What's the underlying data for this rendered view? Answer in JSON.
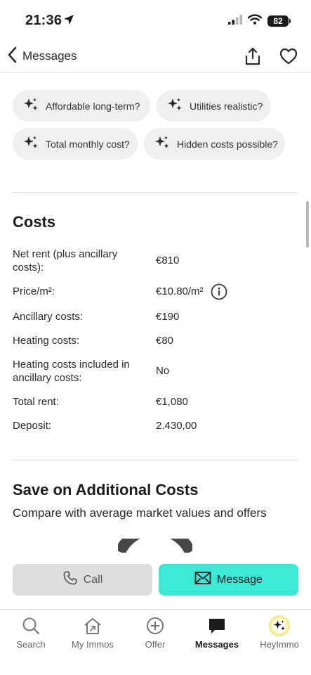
{
  "status": {
    "time": "21:36",
    "battery": "82"
  },
  "header": {
    "back_label": "Messages"
  },
  "chips": [
    {
      "label": "Affordable long-term?"
    },
    {
      "label": "Utilities realistic?"
    },
    {
      "label": "Total monthly cost?"
    },
    {
      "label": "Hidden costs possible?"
    }
  ],
  "costs": {
    "title": "Costs",
    "rows": [
      {
        "label": "Net rent (plus ancillary costs):",
        "value": "€810"
      },
      {
        "label": "Price/m²:",
        "value": "€10.80/m²"
      },
      {
        "label": "Ancillary costs:",
        "value": "€190"
      },
      {
        "label": "Heating costs:",
        "value": "€80"
      },
      {
        "label": "Heating costs included in ancillary costs:",
        "value": "No"
      },
      {
        "label": "Total rent:",
        "value": "€1,080"
      },
      {
        "label": "Deposit:",
        "value": "2.430,00"
      }
    ]
  },
  "savings": {
    "title": "Save on Additional Costs",
    "subtitle": "Compare with average market values and offers"
  },
  "actions": {
    "call_label": "Call",
    "message_label": "Message"
  },
  "tabs": [
    {
      "label": "Search",
      "icon": "search-icon"
    },
    {
      "label": "My Immos",
      "icon": "home-icon"
    },
    {
      "label": "Offer",
      "icon": "plus-circle-icon"
    },
    {
      "label": "Messages",
      "icon": "chat-icon",
      "active": true
    },
    {
      "label": "HeyImmo",
      "icon": "sparkle-icon"
    }
  ],
  "colors": {
    "accent": "#3ce8d6",
    "chip_bg": "#efefef",
    "call_bg": "#dedede"
  }
}
